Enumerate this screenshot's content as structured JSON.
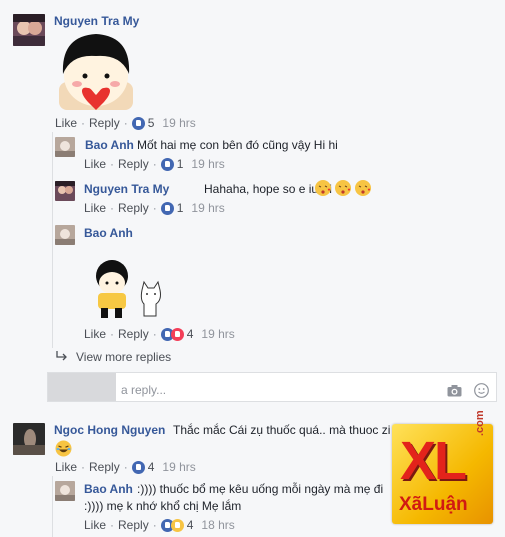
{
  "comments": [
    {
      "name": "Nguyen Tra My",
      "text": "",
      "like": "Like",
      "reply": "Reply",
      "likes": "5",
      "time": "19 hrs"
    },
    {
      "name": "Bao Anh",
      "text": "Mốt hai mẹ con bên đó cũng vậy Hi hi",
      "like": "Like",
      "reply": "Reply",
      "likes": "1",
      "time": "19 hrs"
    },
    {
      "name": "Nguyen Tra My",
      "text": "Hahaha, hope so e iu ơi",
      "like": "Like",
      "reply": "Reply",
      "likes": "1",
      "time": "19 hrs"
    },
    {
      "name": "Bao Anh",
      "text": "",
      "like": "Like",
      "reply": "Reply",
      "likes": "4",
      "time": "19 hrs"
    },
    {
      "name": "Ngoc Hong Nguyen",
      "text": "Thắc mắc Cái zụ thuốc quá.. mà thuoc zi",
      "like": "Like",
      "reply": "Reply",
      "likes": "4",
      "time": "19 hrs"
    },
    {
      "name": "Bao Anh",
      "text": ":)))) thuốc bổ mẹ kêu uống mỗi ngày mà mẹ đi",
      "text2": ":)))) mẹ k nhớ khổ chị Mẹ lắm",
      "like": "Like",
      "reply": "Reply",
      "likes": "4",
      "time": "18 hrs"
    }
  ],
  "view_more": "View more replies",
  "reply_placeholder": "a reply...",
  "watermark": {
    "big": "XL",
    "small": "XãLuận",
    "domain": ".com"
  },
  "colors": {
    "link": "#365899",
    "like_blue": "#4267b2",
    "love_red": "#f33e58",
    "bg": "#f6f7f9"
  }
}
